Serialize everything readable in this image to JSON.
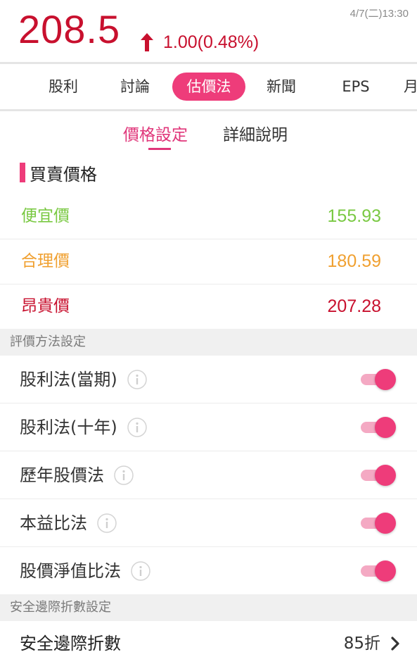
{
  "quote": {
    "price": "208.5",
    "change": "1.00(0.48%)",
    "direction": "up",
    "timestamp": "4/7(二)13:30",
    "up_color": "#c8102e"
  },
  "tabs": [
    {
      "label": "股利",
      "active": false
    },
    {
      "label": "討論",
      "active": false
    },
    {
      "label": "估價法",
      "active": true
    },
    {
      "label": "新聞",
      "active": false
    },
    {
      "label": "EPS",
      "active": false
    },
    {
      "label": "月",
      "active": false
    }
  ],
  "subtabs": [
    {
      "label": "價格設定",
      "active": true
    },
    {
      "label": "詳細說明",
      "active": false
    }
  ],
  "price_section": {
    "title": "買賣價格",
    "rows": [
      {
        "name": "便宜價",
        "value": "155.93",
        "color": "#7ac943"
      },
      {
        "name": "合理價",
        "value": "180.59",
        "color": "#f0a030"
      },
      {
        "name": "昂貴價",
        "value": "207.28",
        "color": "#c8102e"
      }
    ]
  },
  "methods_section": {
    "title": "評價方法設定",
    "items": [
      {
        "label": "股利法(當期)",
        "enabled": true,
        "icon": "info-icon"
      },
      {
        "label": "股利法(十年)",
        "enabled": true,
        "icon": "info-icon"
      },
      {
        "label": "歷年股價法",
        "enabled": true,
        "icon": "info-icon"
      },
      {
        "label": "本益比法",
        "enabled": true,
        "icon": "info-icon"
      },
      {
        "label": "股價淨值比法",
        "enabled": true,
        "icon": "info-icon"
      }
    ]
  },
  "margin_section": {
    "title": "安全邊際折數設定",
    "row_label": "安全邊際折數",
    "row_value": "85折",
    "icon": "chevron-right-icon"
  },
  "colors": {
    "accent": "#ee3c7a",
    "toggle_track": "#f4a9c3",
    "group_bg": "#f0f0f0"
  }
}
